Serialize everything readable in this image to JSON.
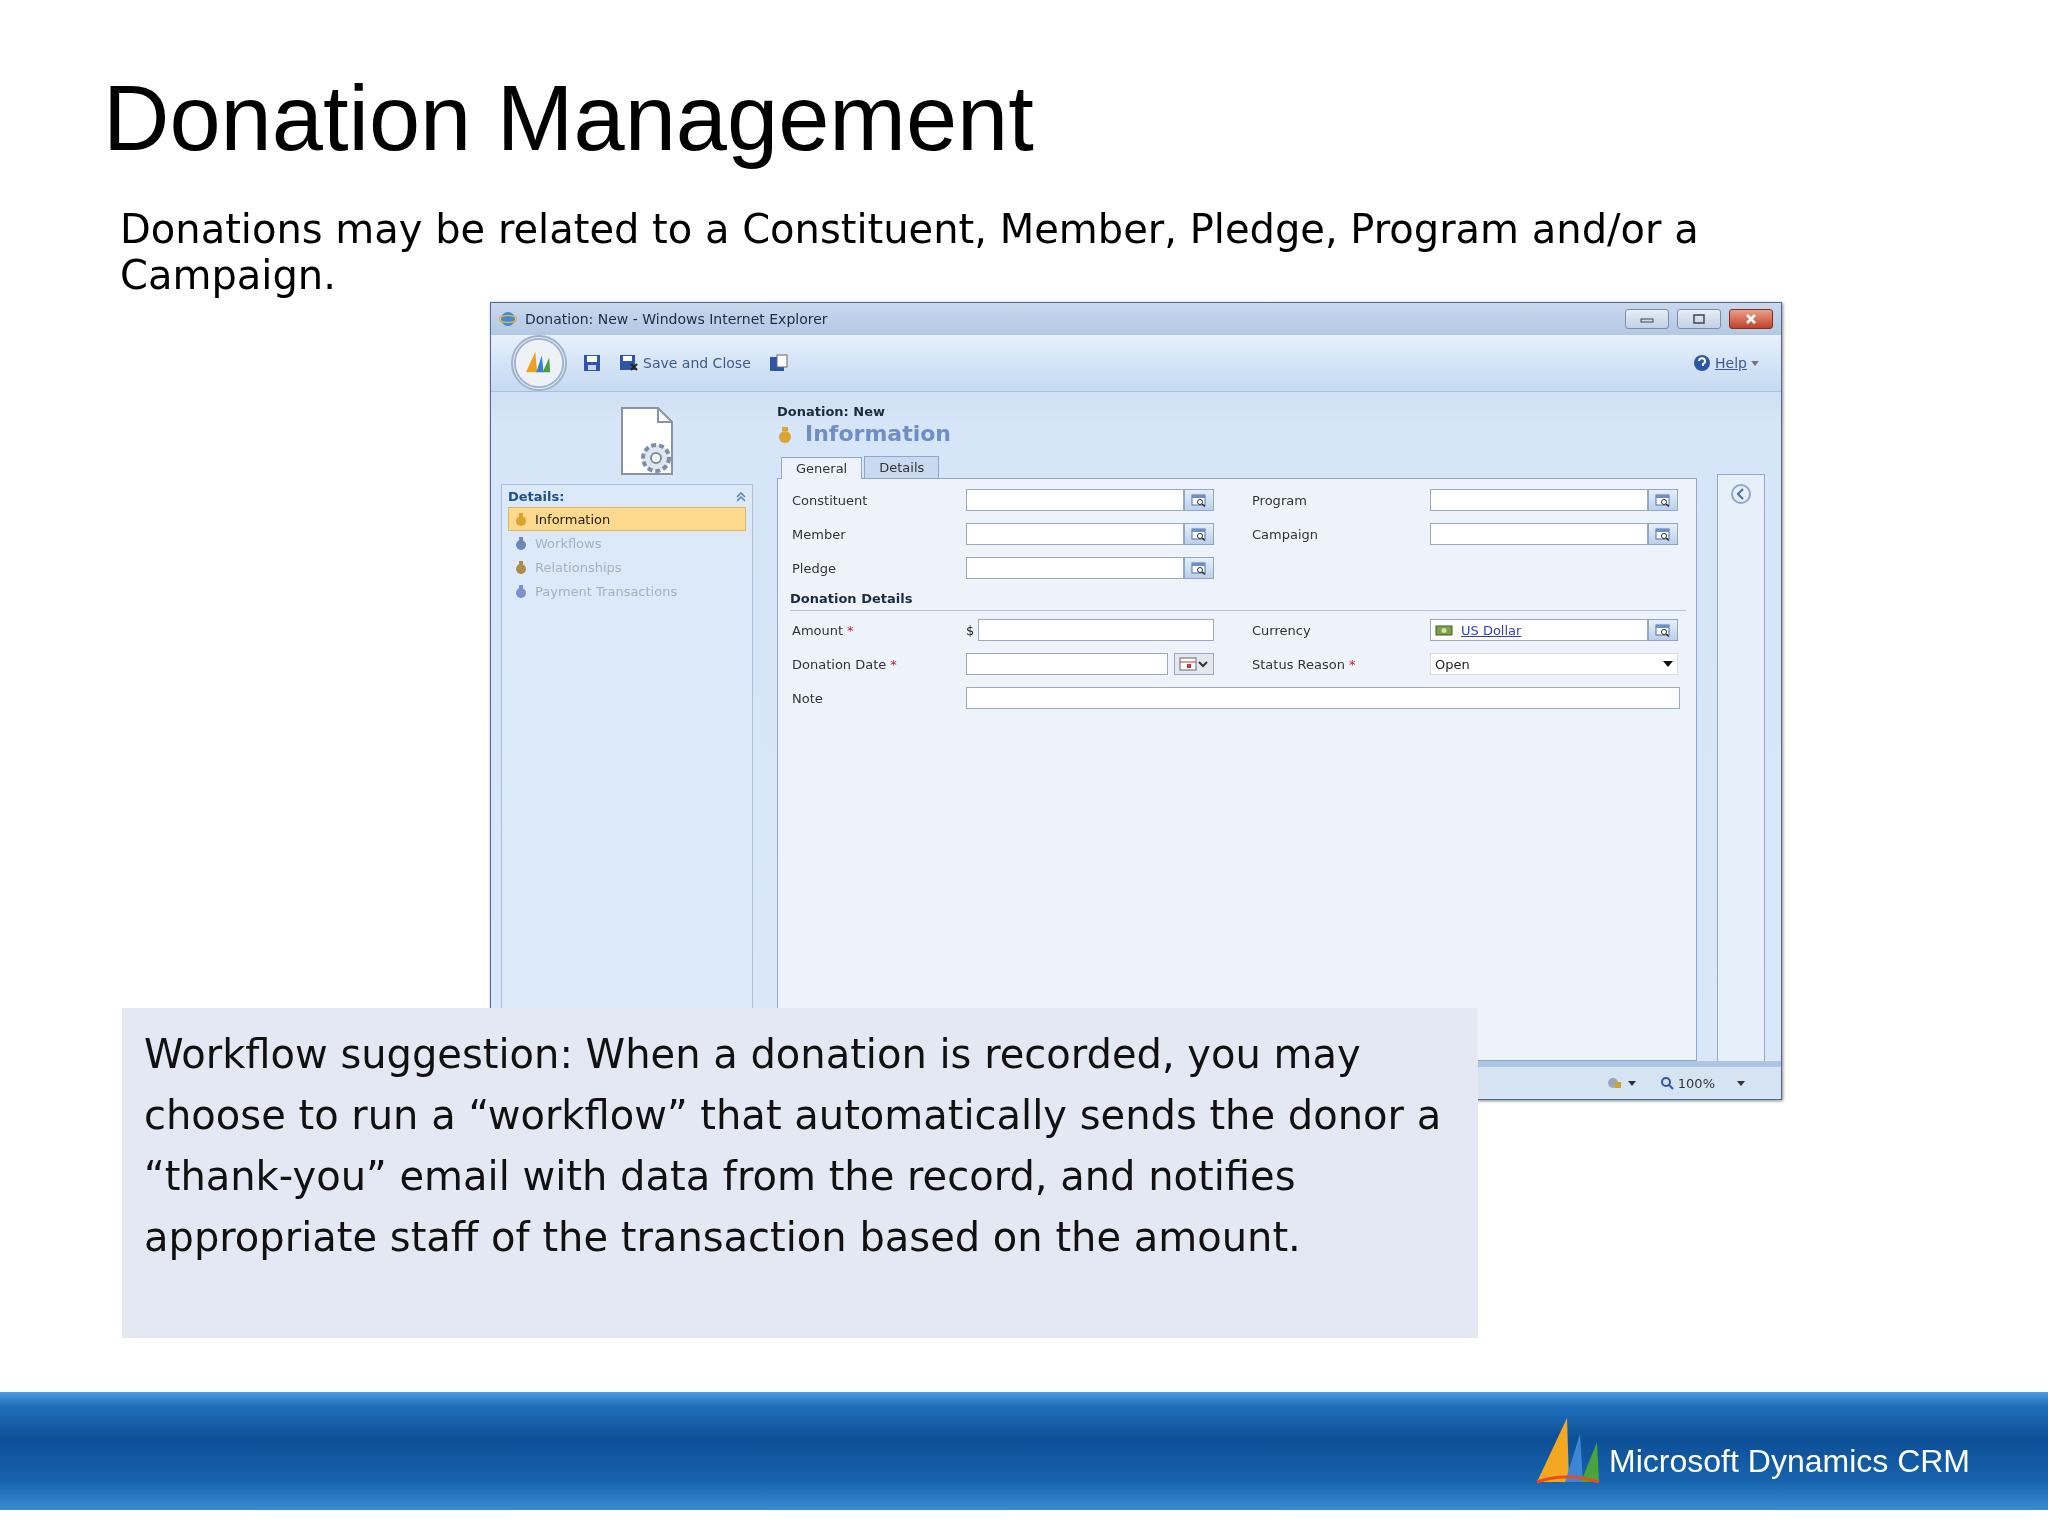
{
  "slide": {
    "title": "Donation Management",
    "subtitle": "Donations may be related to a Constituent, Member, Pledge, Program and/or a Campaign."
  },
  "window": {
    "title": "Donation: New - Windows Internet Explorer",
    "save_and_close": "Save and Close",
    "help": "Help",
    "record": "Donation: New",
    "section_title": "Information",
    "zoom": "100%"
  },
  "nav": {
    "heading": "Details:",
    "items": [
      {
        "label": "Information",
        "selected": true,
        "disabled": false
      },
      {
        "label": "Workflows",
        "selected": false,
        "disabled": true
      },
      {
        "label": "Relationships",
        "selected": false,
        "disabled": true
      },
      {
        "label": "Payment Transactions",
        "selected": false,
        "disabled": true
      }
    ]
  },
  "tabs": [
    {
      "label": "General",
      "selected": true
    },
    {
      "label": "Details",
      "selected": false
    }
  ],
  "general_rows": [
    [
      {
        "label": "Constituent",
        "kind": "lookup"
      },
      {
        "label": "Program",
        "kind": "lookup"
      }
    ],
    [
      {
        "label": "Member",
        "kind": "lookup"
      },
      {
        "label": "Campaign",
        "kind": "lookup"
      }
    ],
    [
      {
        "label": "Pledge",
        "kind": "lookup"
      }
    ]
  ],
  "details_section": {
    "heading": "Donation Details",
    "rows": [
      [
        {
          "label": "Amount",
          "required_mark": "*",
          "kind": "money",
          "prefix": "$"
        },
        {
          "label": "Currency",
          "kind": "lookup",
          "value": "US Dollar"
        }
      ],
      [
        {
          "label": "Donation Date",
          "required_mark": "*",
          "kind": "date"
        },
        {
          "label": "Status Reason",
          "required_mark": "*",
          "kind": "select",
          "value": "Open"
        }
      ],
      [
        {
          "label": "Note",
          "kind": "wide_text"
        }
      ]
    ]
  },
  "callout": {
    "text": "Workflow suggestion: When a donation is recorded, you may choose to run a “workflow” that automatically sends the donor a “thank-you” email with data from the record, and notifies appropriate staff of the transaction based on the amount."
  },
  "footer": {
    "logo_text": "Microsoft Dynamics CRM"
  }
}
